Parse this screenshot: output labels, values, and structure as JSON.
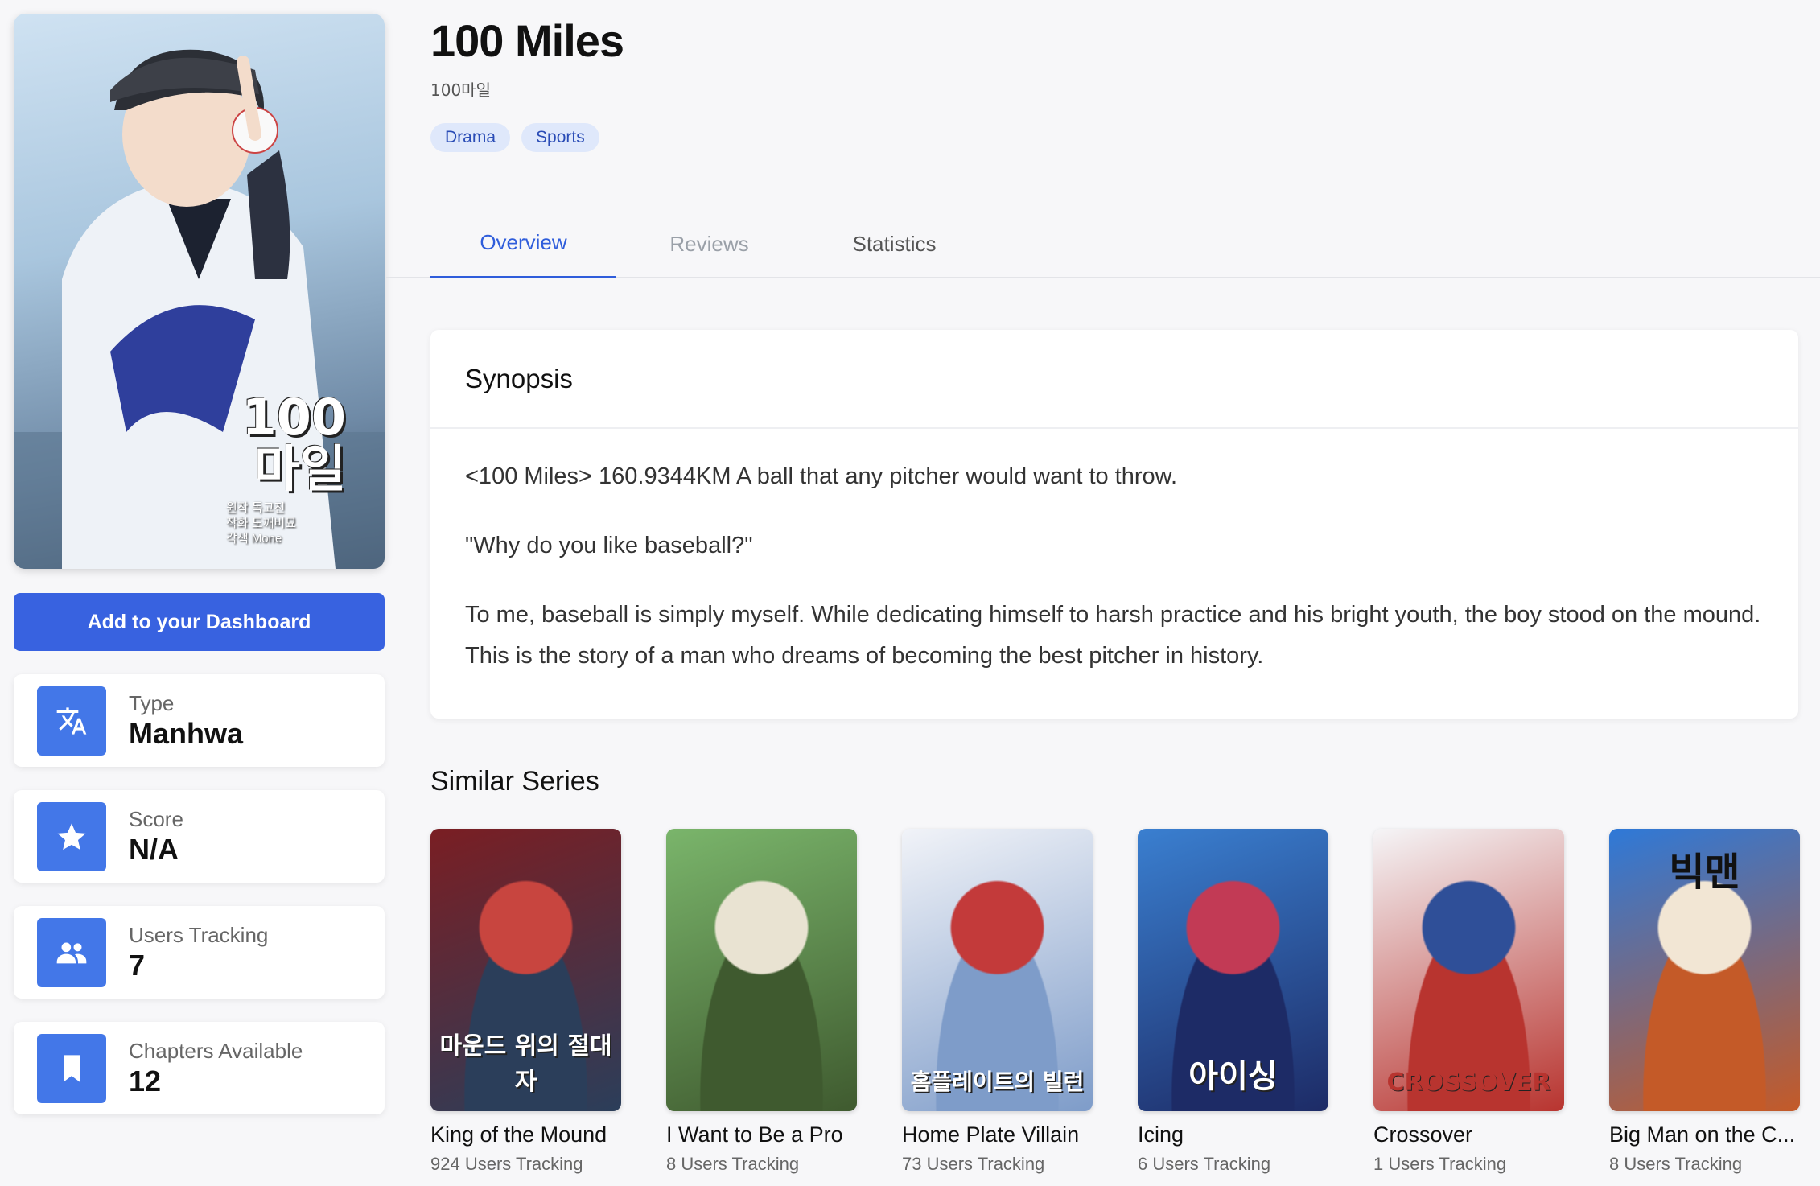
{
  "series": {
    "title": "100 Miles",
    "original_title": "100마일",
    "cover_title_lines": [
      "100",
      "마일"
    ],
    "cover_credits": [
      "원작 독고진",
      "작화 도깨비묘",
      "각색 Mone"
    ],
    "tags": [
      "Drama",
      "Sports"
    ]
  },
  "actions": {
    "add_label": "Add to your Dashboard"
  },
  "stats": [
    {
      "label": "Type",
      "value": "Manhwa",
      "icon": "translate-icon"
    },
    {
      "label": "Score",
      "value": "N/A",
      "icon": "star-icon"
    },
    {
      "label": "Users Tracking",
      "value": "7",
      "icon": "users-icon"
    },
    {
      "label": "Chapters Available",
      "value": "12",
      "icon": "bookmark-icon"
    }
  ],
  "tabs": {
    "overview": "Overview",
    "reviews": "Reviews",
    "statistics": "Statistics"
  },
  "synopsis": {
    "heading": "Synopsis",
    "paragraphs": [
      "<100 Miles> 160.9344KM A ball that any pitcher would want to throw.",
      "\"Why do you like baseball?\"",
      "To me, baseball is simply myself. While dedicating himself to harsh practice and his bright youth, the boy stood on the mound. This is the story of a man who dreams of becoming the best pitcher in history."
    ]
  },
  "similar": {
    "heading": "Similar Series",
    "items": [
      {
        "name": "King of the Mound",
        "tracking": "924 Users Tracking",
        "logo": "마운드 위의 절대자",
        "colors": [
          "#7a1e23",
          "#c8453f",
          "#2b3e5a"
        ]
      },
      {
        "name": "I Want to Be a Pro",
        "tracking": "8 Users Tracking",
        "logo": "",
        "colors": [
          "#7ab56b",
          "#e9e3d2",
          "#3f5a2f"
        ]
      },
      {
        "name": "Home Plate Villain",
        "tracking": "73 Users Tracking",
        "logo": "홈플레이트의 빌런",
        "colors": [
          "#f1f3f8",
          "#c33a3a",
          "#7e9cc9"
        ]
      },
      {
        "name": "Icing",
        "tracking": "6 Users Tracking",
        "logo": "아이싱",
        "colors": [
          "#3a7fd0",
          "#c23a55",
          "#1d2b66"
        ]
      },
      {
        "name": "Crossover",
        "tracking": "1 Users Tracking",
        "logo": "CROSSOVER",
        "colors": [
          "#f5f5f7",
          "#2f4f98",
          "#b8342f"
        ]
      },
      {
        "name": "Big Man on the C...",
        "tracking": "8 Users Tracking",
        "logo": "빅맨",
        "colors": [
          "#2e79d8",
          "#f2e6d4",
          "#c45a28"
        ]
      }
    ]
  }
}
